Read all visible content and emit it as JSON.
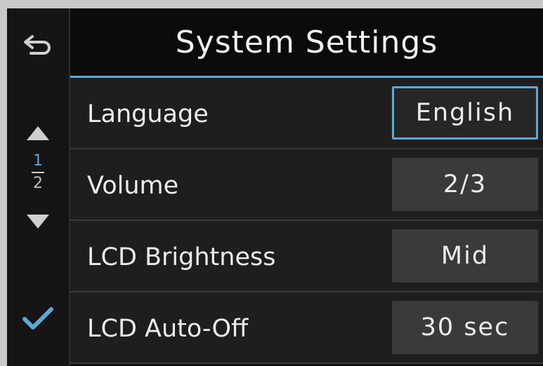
{
  "header": {
    "title": "System Settings"
  },
  "nav": {
    "back_icon": "back-arrow-icon",
    "up_icon": "triangle-up-icon",
    "down_icon": "triangle-down-icon",
    "confirm_icon": "checkmark-icon",
    "page_current": "1",
    "page_total": "2"
  },
  "settings": [
    {
      "label": "Language",
      "value": "English",
      "selected": true
    },
    {
      "label": "Volume",
      "value": "2/3",
      "selected": false
    },
    {
      "label": "LCD Brightness",
      "value": "Mid",
      "selected": false
    },
    {
      "label": "LCD Auto-Off",
      "value": "30 sec",
      "selected": false
    }
  ],
  "colors": {
    "accent": "#5aa9d8",
    "background": "#101010",
    "row": "#1e1e1e",
    "value_box": "#3a3a3a",
    "text": "#ececec"
  }
}
